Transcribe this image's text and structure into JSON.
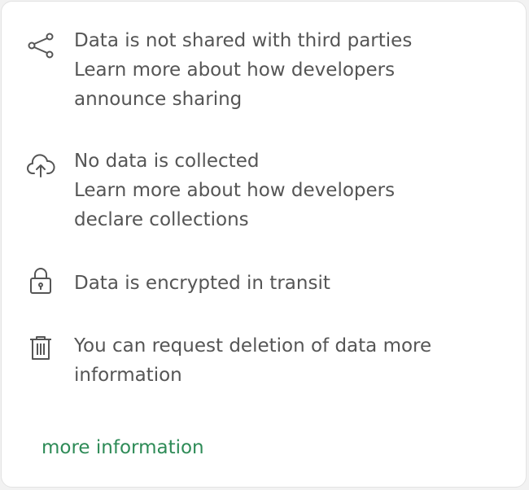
{
  "items": [
    {
      "icon": "share-icon",
      "lines": [
        "Data is not shared with third parties",
        "Learn more about how developers",
        "announce sharing"
      ]
    },
    {
      "icon": "cloud-upload-icon",
      "lines": [
        "No data is collected",
        "Learn more about how developers",
        "declare collections"
      ]
    },
    {
      "icon": "lock-icon",
      "lines": [
        "Data is encrypted in transit"
      ]
    },
    {
      "icon": "trash-icon",
      "lines": [
        "You can request deletion of data more",
        "information"
      ]
    }
  ],
  "more_link": "more information",
  "colors": {
    "text": "#555555",
    "link": "#2e8b57",
    "border": "#e3e3e3"
  }
}
